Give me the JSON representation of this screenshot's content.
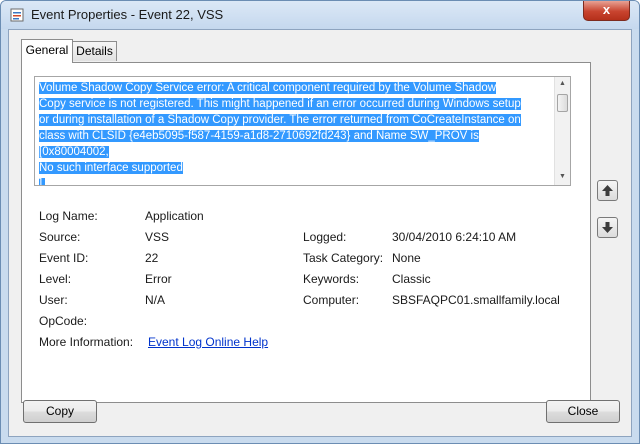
{
  "window": {
    "title": "Event Properties - Event 22, VSS",
    "close_glyph": "x"
  },
  "tabs": [
    {
      "label": "General"
    },
    {
      "label": "Details"
    }
  ],
  "description": {
    "lines": [
      "Volume Shadow Copy Service error: A critical component required by the Volume Shadow",
      "Copy service is not registered. This might happened if an error occurred during Windows setup",
      "or during installation of a Shadow Copy provider. The error returned from CoCreateInstance on",
      "class with CLSID {e4eb5095-f587-4159-a1d8-2710692fd243} and Name SW_PROV is [0x80004002,",
      "No such interface supported",
      "]."
    ]
  },
  "fields": {
    "log_name": {
      "label": "Log Name:",
      "value": "Application"
    },
    "source": {
      "label": "Source:",
      "value": "VSS"
    },
    "logged": {
      "label": "Logged:",
      "value": "30/04/2010 6:24:10 AM"
    },
    "event_id": {
      "label": "Event ID:",
      "value": "22"
    },
    "task_category": {
      "label": "Task Category:",
      "value": "None"
    },
    "level": {
      "label": "Level:",
      "value": "Error"
    },
    "keywords": {
      "label": "Keywords:",
      "value": "Classic"
    },
    "user": {
      "label": "User:",
      "value": "N/A"
    },
    "computer": {
      "label": "Computer:",
      "value": "SBSFAQPC01.smallfamily.local"
    },
    "opcode": {
      "label": "OpCode:",
      "value": ""
    },
    "more_info": {
      "label": "More Information:",
      "link": "Event Log Online Help"
    }
  },
  "buttons": {
    "copy": "Copy",
    "close": "Close"
  },
  "icons": {
    "app": "event-viewer-icon",
    "up": "arrow-up-icon",
    "down": "arrow-down-icon"
  },
  "colors": {
    "selection": "#3399ff",
    "link": "#0033cc",
    "close_button": "#c8442f"
  }
}
